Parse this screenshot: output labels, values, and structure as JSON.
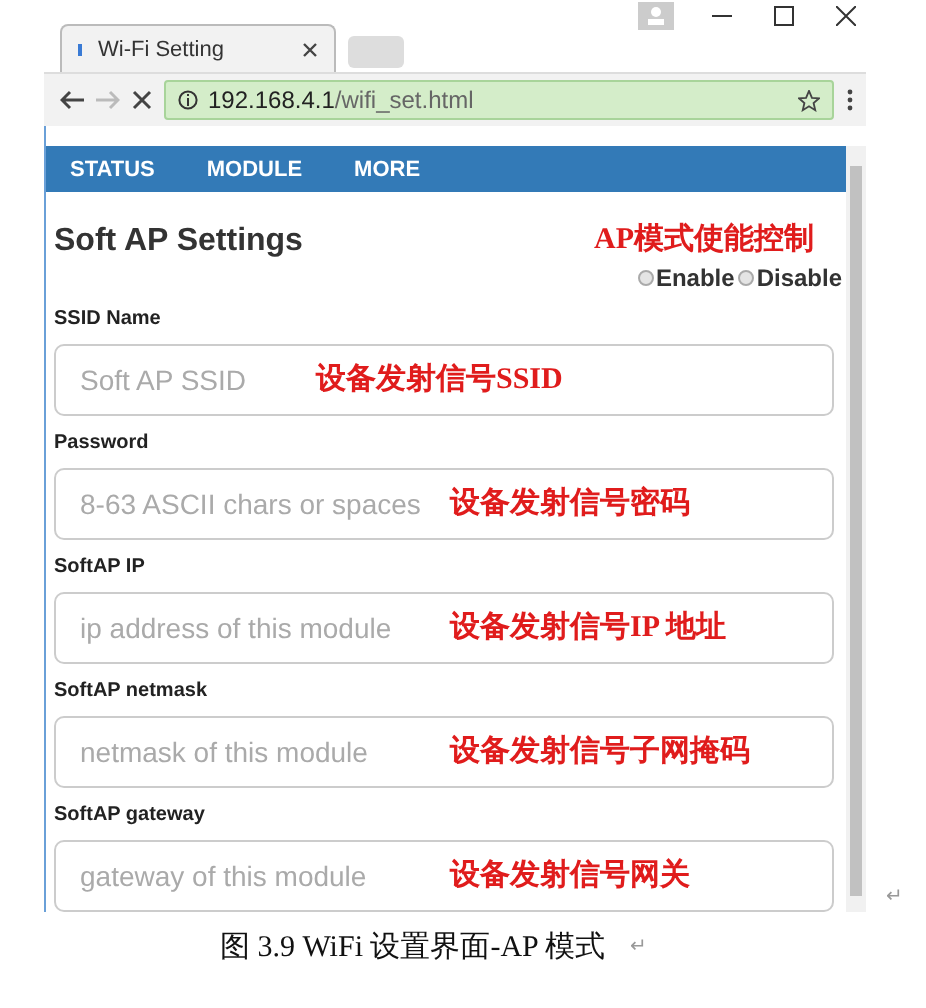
{
  "browser": {
    "tab_title": "Wi-Fi Setting",
    "url_host": "192.168.4.1",
    "url_path": "/wifi_set.html"
  },
  "nav": [
    {
      "label": "STATUS"
    },
    {
      "label": "MODULE"
    },
    {
      "label": "MORE"
    }
  ],
  "section": {
    "title": "Soft AP Settings",
    "annotation": "AP模式使能控制",
    "options": [
      {
        "label": "Enable",
        "selected": false
      },
      {
        "label": "Disable",
        "selected": false
      }
    ]
  },
  "fields": [
    {
      "label": "SSID Name",
      "placeholder": "Soft AP SSID",
      "annotation": "设备发射信号SSID"
    },
    {
      "label": "Password",
      "placeholder": "8-63 ASCII chars or spaces",
      "annotation": "设备发射信号密码"
    },
    {
      "label": "SoftAP IP",
      "placeholder": "ip address of this module",
      "annotation": "设备发射信号IP 地址"
    },
    {
      "label": "SoftAP netmask",
      "placeholder": "netmask of this module",
      "annotation": "设备发射信号子网掩码"
    },
    {
      "label": "SoftAP gateway",
      "placeholder": "gateway of this module",
      "annotation": "设备发射信号网关"
    }
  ],
  "caption": "图 3.9 WiFi 设置界面-AP 模式",
  "return_marks": [
    "↵",
    "↵"
  ]
}
